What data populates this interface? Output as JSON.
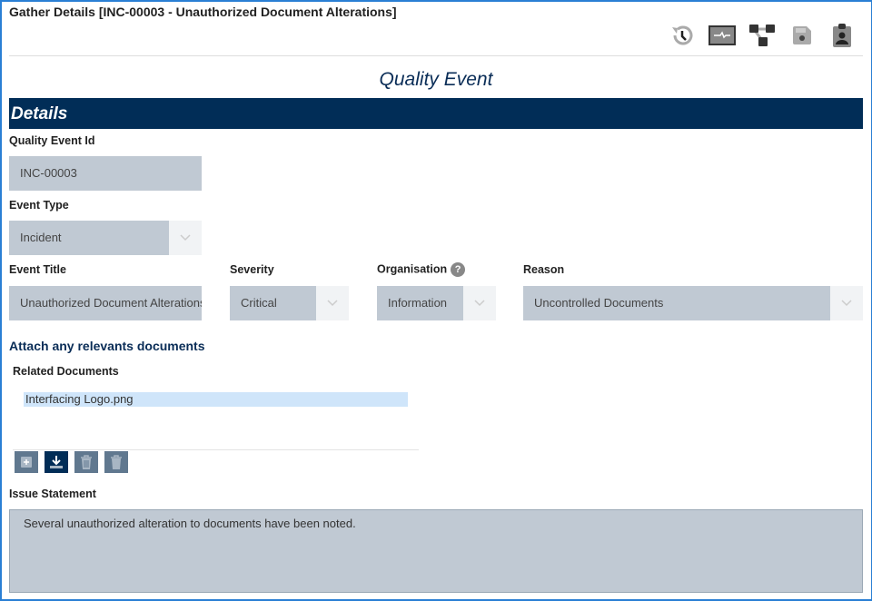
{
  "window": {
    "title": "Gather Details [INC-00003 - Unauthorized Document Alterations]"
  },
  "toolbar": {
    "icons": [
      "history-icon",
      "monitor-icon",
      "workflow-icon",
      "save-icon",
      "clipboard-user-icon"
    ]
  },
  "form": {
    "title": "Quality Event",
    "section": "Details",
    "quality_event_id": {
      "label": "Quality Event Id",
      "value": "INC-00003"
    },
    "event_type": {
      "label": "Event Type",
      "value": "Incident"
    },
    "event_title": {
      "label": "Event Title",
      "value": "Unauthorized Document Alterations"
    },
    "severity": {
      "label": "Severity",
      "value": "Critical"
    },
    "organisation": {
      "label": "Organisation",
      "value": "Information",
      "help": "?"
    },
    "reason": {
      "label": "Reason",
      "value": "Uncontrolled Documents"
    },
    "attach_heading": "Attach any relevants documents",
    "related_documents": {
      "label": "Related Documents",
      "items": [
        "Interfacing Logo.png"
      ]
    },
    "issue_statement": {
      "label": "Issue Statement",
      "value": "Several unauthorized alteration to documents have been noted."
    }
  },
  "colors": {
    "navy": "#012d57",
    "field": "#c0c9d3",
    "selection": "#cfe5fa"
  }
}
